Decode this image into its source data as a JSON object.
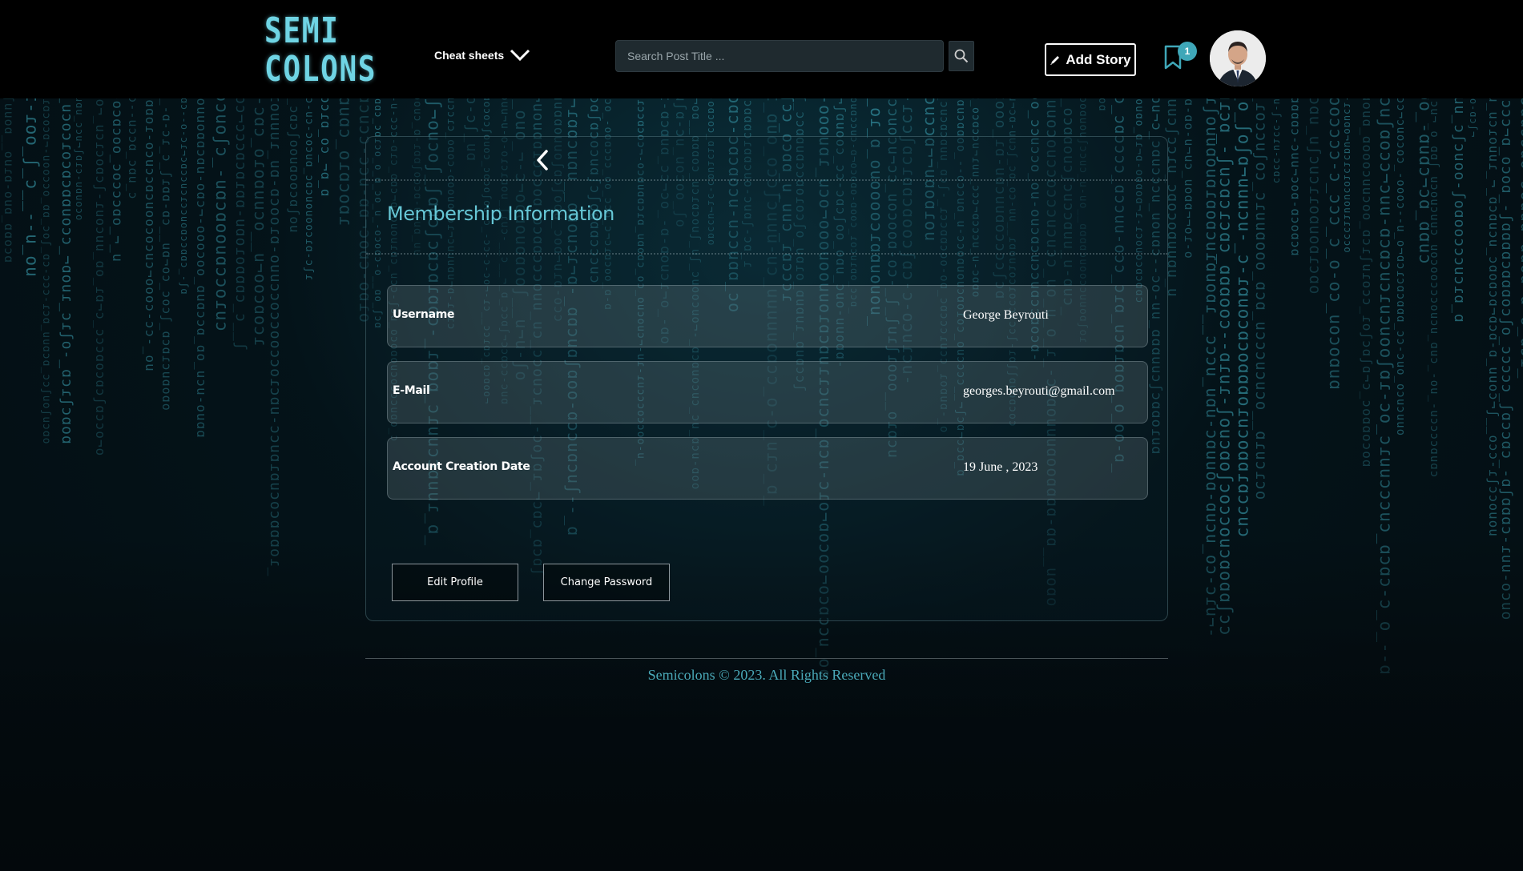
{
  "header": {
    "logo_line1": "SEMI",
    "logo_line2": "COLONS",
    "menu_label": "Cheat sheets",
    "search_placeholder": "Search Post Title ...",
    "add_story_label": "Add Story",
    "notification_count": "1",
    "icons": {
      "menu": "chevron-down-icon",
      "search": "search-icon",
      "add_story": "pencil-icon",
      "notifications": "bookmark-icon"
    }
  },
  "card": {
    "title": "Membership Information",
    "rows": [
      {
        "label": "Username",
        "value": "George Beyrouti"
      },
      {
        "label": "E-Mail",
        "value": "georges.beyrouti@gmail.com"
      },
      {
        "label": "Account Creation Date",
        "value": "19 June , 2023"
      }
    ],
    "edit_profile_label": "Edit Profile",
    "change_password_label": "Change Password"
  },
  "footer": {
    "text": "Semicolons © 2023. All Rights Reserved"
  },
  "colors": {
    "accent": "#66c7d6",
    "footer_text": "#4aa9b8",
    "badge": "#3fa7b8",
    "header_bg": "#000000"
  }
}
